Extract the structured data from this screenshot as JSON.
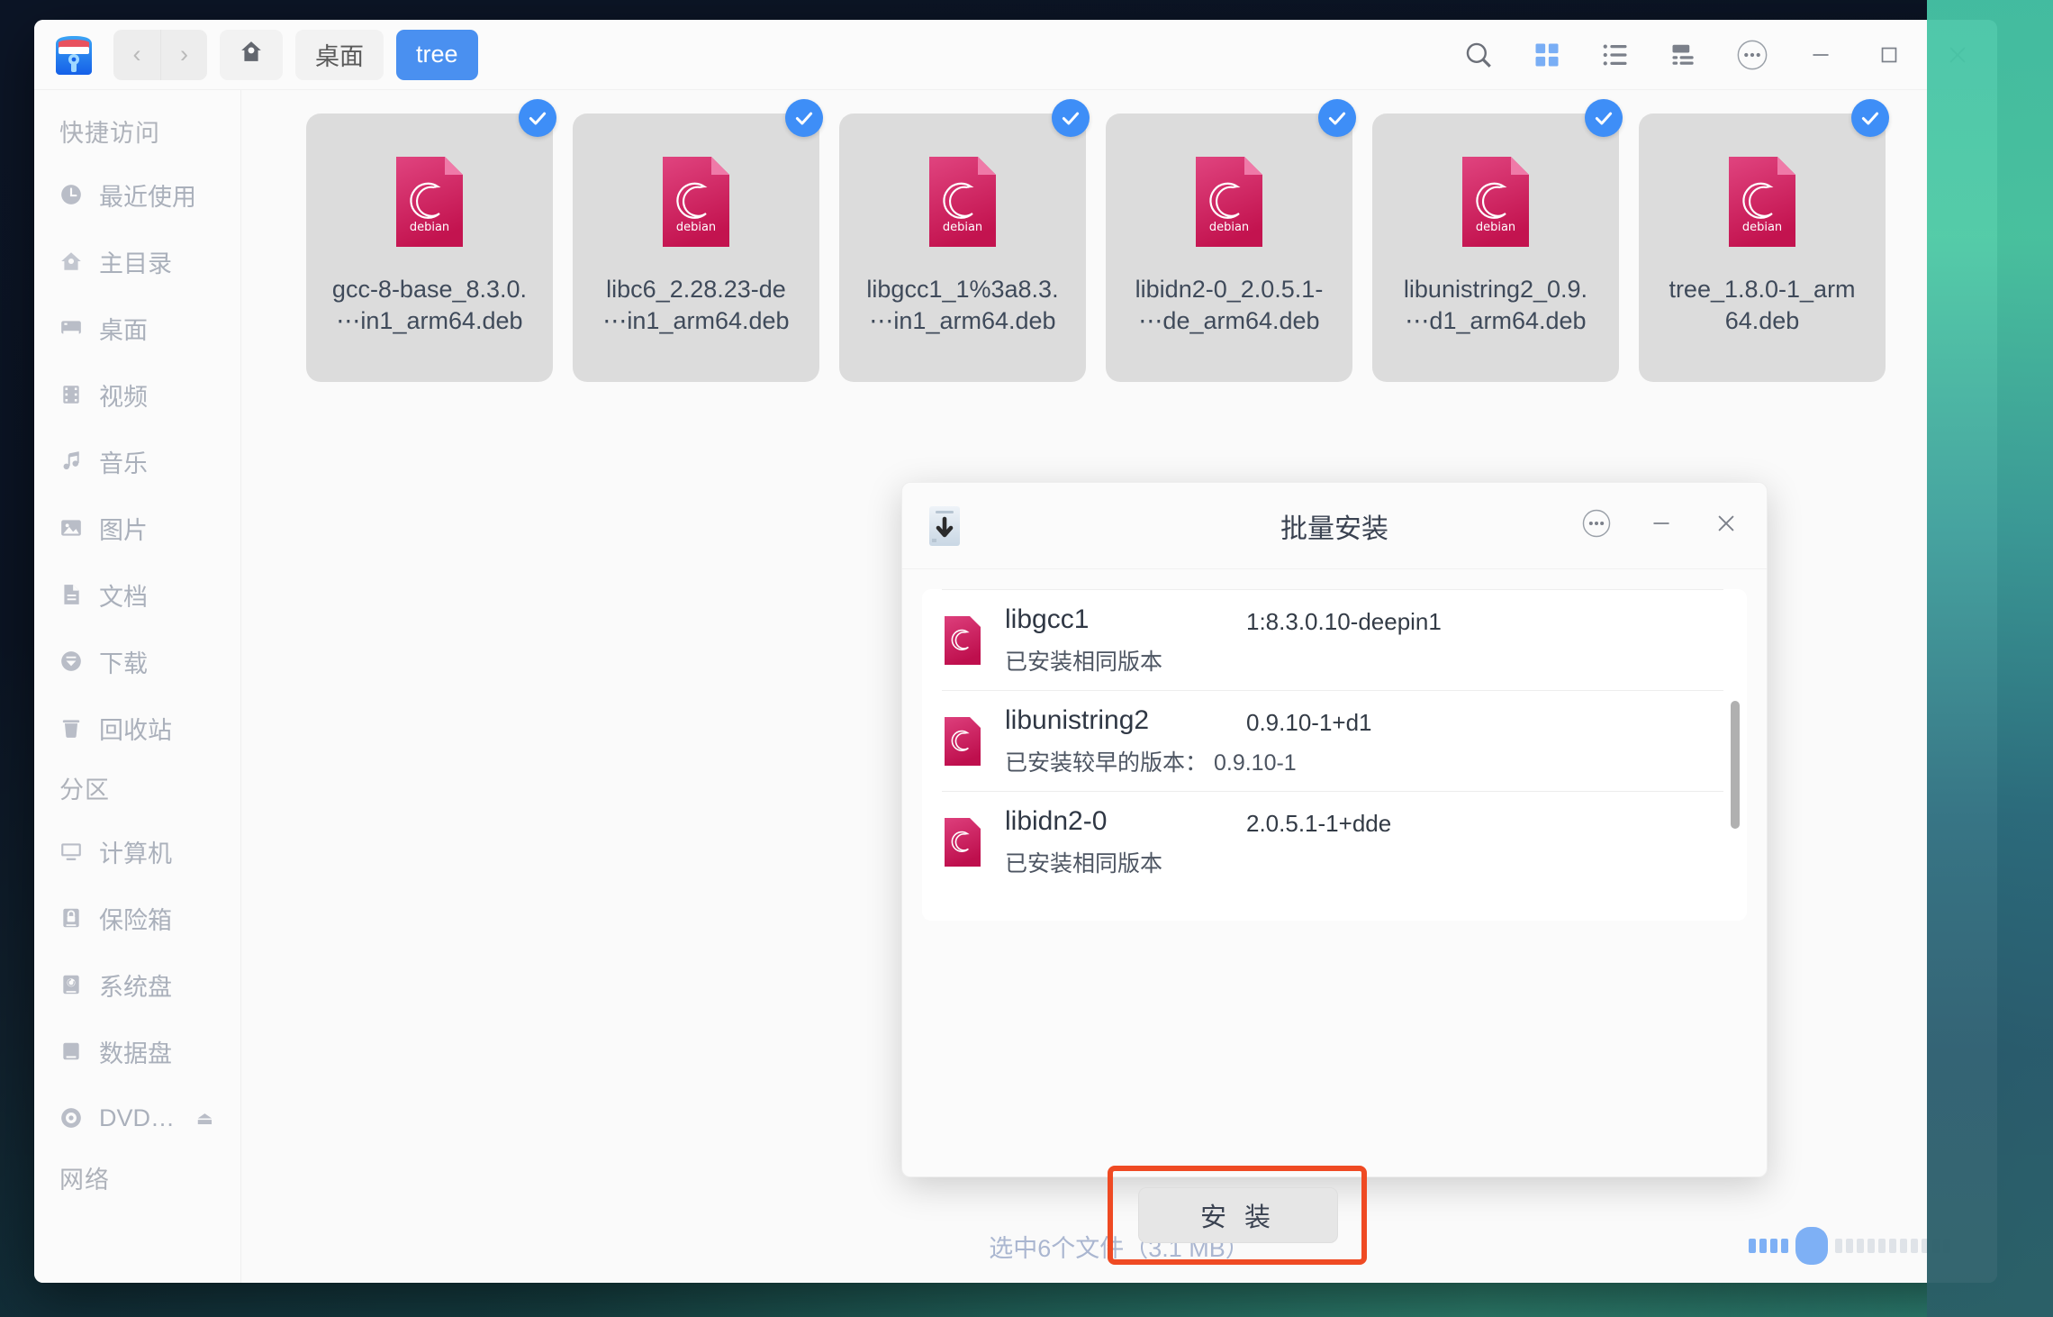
{
  "window": {
    "app_icon": "file-manager-icon",
    "nav": {
      "back": "‹",
      "forward": "›"
    },
    "home_icon": "home-icon",
    "breadcrumbs": [
      {
        "label": "桌面",
        "active": false
      },
      {
        "label": "tree",
        "active": true
      }
    ],
    "toolbar_icons": [
      {
        "name": "search-icon",
        "label": "搜索"
      },
      {
        "name": "icon-view-icon",
        "label": "图标视图",
        "active": true
      },
      {
        "name": "list-view-icon",
        "label": "列表视图",
        "active": false
      },
      {
        "name": "detail-view-icon",
        "label": "分栏视图",
        "active": false
      },
      {
        "name": "more-options-icon",
        "label": "更多选项"
      },
      {
        "name": "minimize-icon",
        "label": "最小化"
      },
      {
        "name": "maximize-icon",
        "label": "最大化"
      },
      {
        "name": "close-icon",
        "label": "关闭"
      }
    ]
  },
  "sidebar": {
    "sections": [
      {
        "header": "快捷访问",
        "items": [
          {
            "label": "最近使用",
            "icon": "clock-icon"
          },
          {
            "label": "主目录",
            "icon": "home-icon"
          },
          {
            "label": "桌面",
            "icon": "desktop-icon"
          },
          {
            "label": "视频",
            "icon": "video-icon"
          },
          {
            "label": "音乐",
            "icon": "music-icon"
          },
          {
            "label": "图片",
            "icon": "picture-icon"
          },
          {
            "label": "文档",
            "icon": "document-icon"
          },
          {
            "label": "下载",
            "icon": "download-icon"
          },
          {
            "label": "回收站",
            "icon": "trash-icon"
          }
        ]
      },
      {
        "header": "分区",
        "items": [
          {
            "label": "计算机",
            "icon": "computer-icon"
          },
          {
            "label": "保险箱",
            "icon": "vault-icon"
          },
          {
            "label": "系统盘",
            "icon": "system-disk-icon"
          },
          {
            "label": "数据盘",
            "icon": "data-disk-icon"
          },
          {
            "label": "DVD…",
            "icon": "dvd-icon",
            "eject": "⏏"
          }
        ]
      },
      {
        "header": "网络",
        "items": []
      }
    ]
  },
  "files": [
    {
      "line1": "gcc-8-base_8.3.0.",
      "line2": "⋯in1_arm64.deb",
      "selected": true,
      "icon": "debian-package-icon"
    },
    {
      "line1": "libc6_2.28.23-de",
      "line2": "⋯in1_arm64.deb",
      "selected": true,
      "icon": "debian-package-icon"
    },
    {
      "line1": "libgcc1_1%3a8.3.",
      "line2": "⋯in1_arm64.deb",
      "selected": true,
      "icon": "debian-package-icon"
    },
    {
      "line1": "libidn2-0_2.0.5.1-",
      "line2": "⋯de_arm64.deb",
      "selected": true,
      "icon": "debian-package-icon"
    },
    {
      "line1": "libunistring2_0.9.",
      "line2": "⋯d1_arm64.deb",
      "selected": true,
      "icon": "debian-package-icon"
    },
    {
      "line1": "tree_1.8.0-1_arm",
      "line2": "64.deb",
      "selected": true,
      "icon": "debian-package-icon"
    }
  ],
  "statusbar": {
    "text": "选中6个文件（3.1 MB）",
    "zoom_slider": {
      "name": "icon-size-slider",
      "position": 5,
      "total": 20
    }
  },
  "dialog": {
    "icon": "package-installer-icon",
    "title": "批量安装",
    "controls": [
      {
        "name": "more-options-icon",
        "label": "更多选项"
      },
      {
        "name": "minimize-icon",
        "label": "最小化"
      },
      {
        "name": "close-icon",
        "label": "关闭"
      }
    ],
    "packages": [
      {
        "name": "libgcc1",
        "version": "1:8.3.0.10-deepin1",
        "status": "已安装相同版本",
        "status_extra": ""
      },
      {
        "name": "libunistring2",
        "version": "0.9.10-1+d1",
        "status": "已安装较早的版本：",
        "status_extra": "0.9.10-1"
      },
      {
        "name": "libidn2-0",
        "version": "2.0.5.1-1+dde",
        "status": "已安装相同版本",
        "status_extra": ""
      }
    ],
    "install_button": "安 装",
    "highlight_color": "#ef4a23"
  },
  "colors": {
    "accent": "#4a90f0",
    "check_blue": "#3e8ef7",
    "debian_pink": "#d1185c",
    "highlight": "#ef4a23",
    "tile_gray": "#dcdcdc"
  }
}
